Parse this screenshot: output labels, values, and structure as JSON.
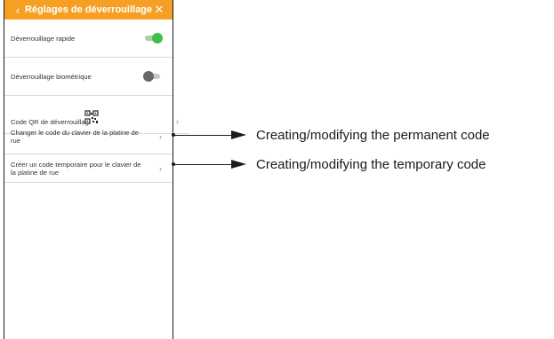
{
  "header": {
    "title": "Réglages de déverrouillage",
    "back_icon": "‹",
    "close_icon": "✕",
    "color": "#f5a025"
  },
  "settings": [
    {
      "label": "Déverrouillage rapide",
      "control": "toggle",
      "state": "on"
    },
    {
      "label": "Déverrouillage biométrique",
      "control": "toggle",
      "state": "off"
    },
    {
      "label": "Code QR de déverrouillage",
      "control": "chevron",
      "icon": "qr-code-icon"
    },
    {
      "label": "Changer le code du clavier de la platine de rue",
      "control": "chevron"
    },
    {
      "label": "Créer un code temporaire pour le clavier de la platine de rue",
      "control": "chevron"
    }
  ],
  "chevron": "›",
  "callouts": [
    {
      "text": "Creating/modifying the permanent code"
    },
    {
      "text": "Creating/modifying the temporary code"
    }
  ],
  "colors": {
    "toggle_on": "#3fbf4a",
    "toggle_off": "#666666",
    "accent": "#f5a025"
  }
}
